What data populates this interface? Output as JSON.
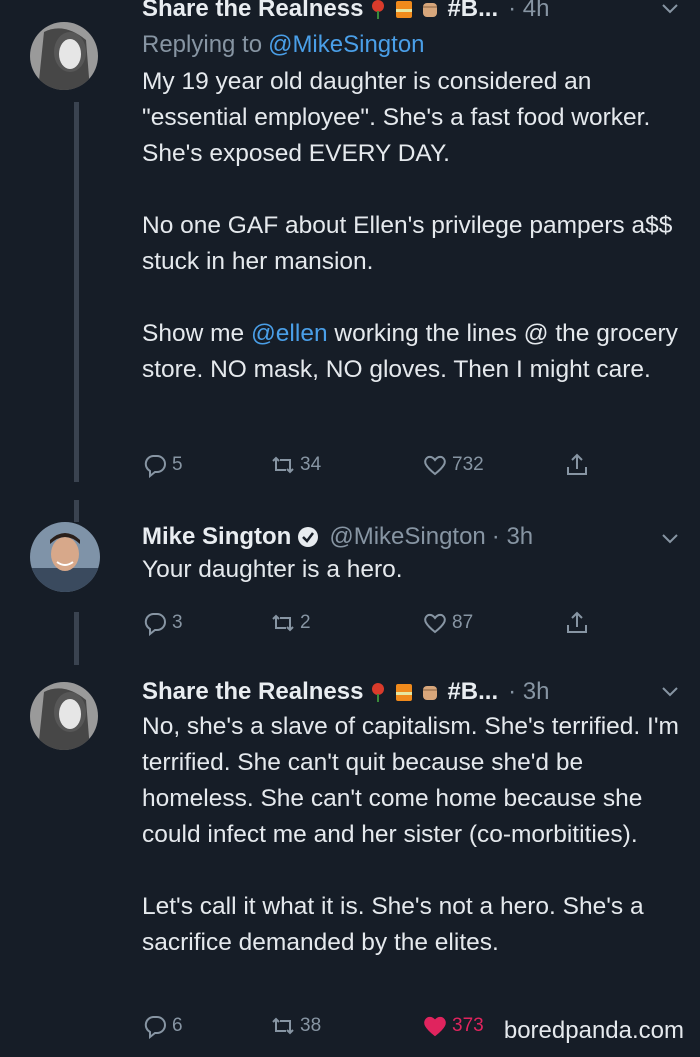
{
  "tweets": [
    {
      "name": "Share the Realness",
      "hashtag": "#B...",
      "time": "· 4h",
      "replying_prefix": "Replying to ",
      "replying_handle": "@MikeSington",
      "paragraphs": [
        "My 19 year old daughter is considered an \"essential employee\". She's a fast food worker. She's exposed EVERY DAY.",
        "No one GAF about Ellen's privilege pampers a$$ stuck in her mansion."
      ],
      "p3_before": "Show me ",
      "p3_mention": "@ellen",
      "p3_after": " working the lines @ the grocery store. NO mask, NO gloves. Then I might care.",
      "replies": "5",
      "retweets": "34",
      "likes": "732"
    },
    {
      "name": "Mike Sington",
      "handle": "@MikeSington",
      "time": "· 3h",
      "text": "Your daughter is a hero.",
      "replies": "3",
      "retweets": "2",
      "likes": "87"
    },
    {
      "name": "Share the Realness",
      "hashtag": "#B...",
      "time": "· 3h",
      "paragraphs": [
        "No, she's a slave of capitalism. She's terrified. I'm terrified. She can't quit because she'd be homeless. She can't come home because she could infect me and her sister (co-morbitities).",
        "Let's call it what it is. She's not a hero. She's a sacrifice demanded by the elites."
      ],
      "replies": "6",
      "retweets": "38",
      "likes": "373"
    }
  ],
  "icons": {
    "reply": "reply-icon",
    "retweet": "retweet-icon",
    "like": "heart-icon",
    "share": "share-icon",
    "verified": "verified-badge-icon",
    "more": "chevron-down-icon"
  },
  "colors": {
    "background": "#161d27",
    "link": "#4a9fe8",
    "muted": "#8795a3",
    "like": "#e0245e"
  },
  "watermark": "boredpanda.com"
}
